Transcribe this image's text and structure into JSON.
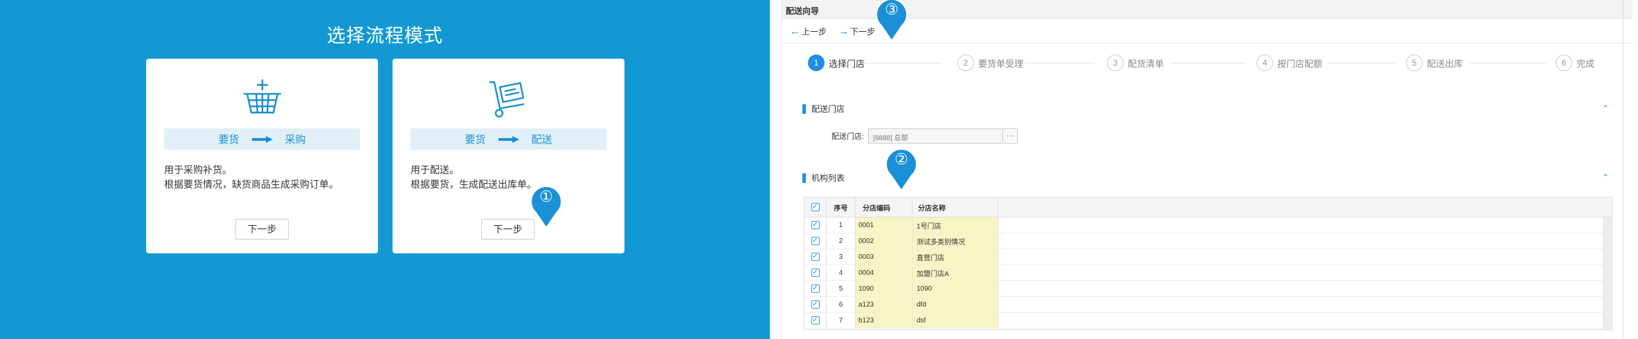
{
  "left": {
    "title": "选择流程模式",
    "cards": [
      {
        "icon": "basket-icon",
        "flow_from": "要货",
        "flow_to": "采购",
        "desc_line1": "用于采购补货。",
        "desc_line2": "根据要货情况，缺货商品生成采购订单。",
        "button": "下一步"
      },
      {
        "icon": "hand-truck-icon",
        "flow_from": "要货",
        "flow_to": "配送",
        "desc_line1": "用于配送。",
        "desc_line2": "根据要货，生成配送出库单。",
        "button": "下一步"
      }
    ]
  },
  "markers": {
    "m1": "①",
    "m2": "②",
    "m3": "③"
  },
  "wizard": {
    "title": "配送向导",
    "toolbar": {
      "prev": "上一步",
      "next": "下一步"
    },
    "steps": [
      {
        "num": "1",
        "label": "选择门店",
        "active": true
      },
      {
        "num": "2",
        "label": "要货单受理"
      },
      {
        "num": "3",
        "label": "配货清单"
      },
      {
        "num": "4",
        "label": "按门店配额"
      },
      {
        "num": "5",
        "label": "配送出库"
      },
      {
        "num": "6",
        "label": "完成"
      }
    ],
    "store_section": {
      "title": "配送门店",
      "field_label": "配送门店:",
      "field_value": "[8888] 总部",
      "more": "···"
    },
    "org_section": {
      "title": "机构列表"
    },
    "table": {
      "headers": {
        "seq": "序号",
        "code": "分店编码",
        "name": "分店名称"
      },
      "rows": [
        {
          "seq": "1",
          "code": "0001",
          "name": "1号门店"
        },
        {
          "seq": "2",
          "code": "0002",
          "name": "测试多类别情况"
        },
        {
          "seq": "3",
          "code": "0003",
          "name": "直营门店"
        },
        {
          "seq": "4",
          "code": "0004",
          "name": "加盟门店A"
        },
        {
          "seq": "5",
          "code": "1090",
          "name": "1090"
        },
        {
          "seq": "6",
          "code": "a123",
          "name": "dfd"
        },
        {
          "seq": "7",
          "code": "b123",
          "name": "dsf"
        }
      ]
    }
  },
  "colors": {
    "primary_bg": "#1299d3",
    "accent": "#1f8ee6",
    "highlight_cell": "#f7f5c4"
  }
}
